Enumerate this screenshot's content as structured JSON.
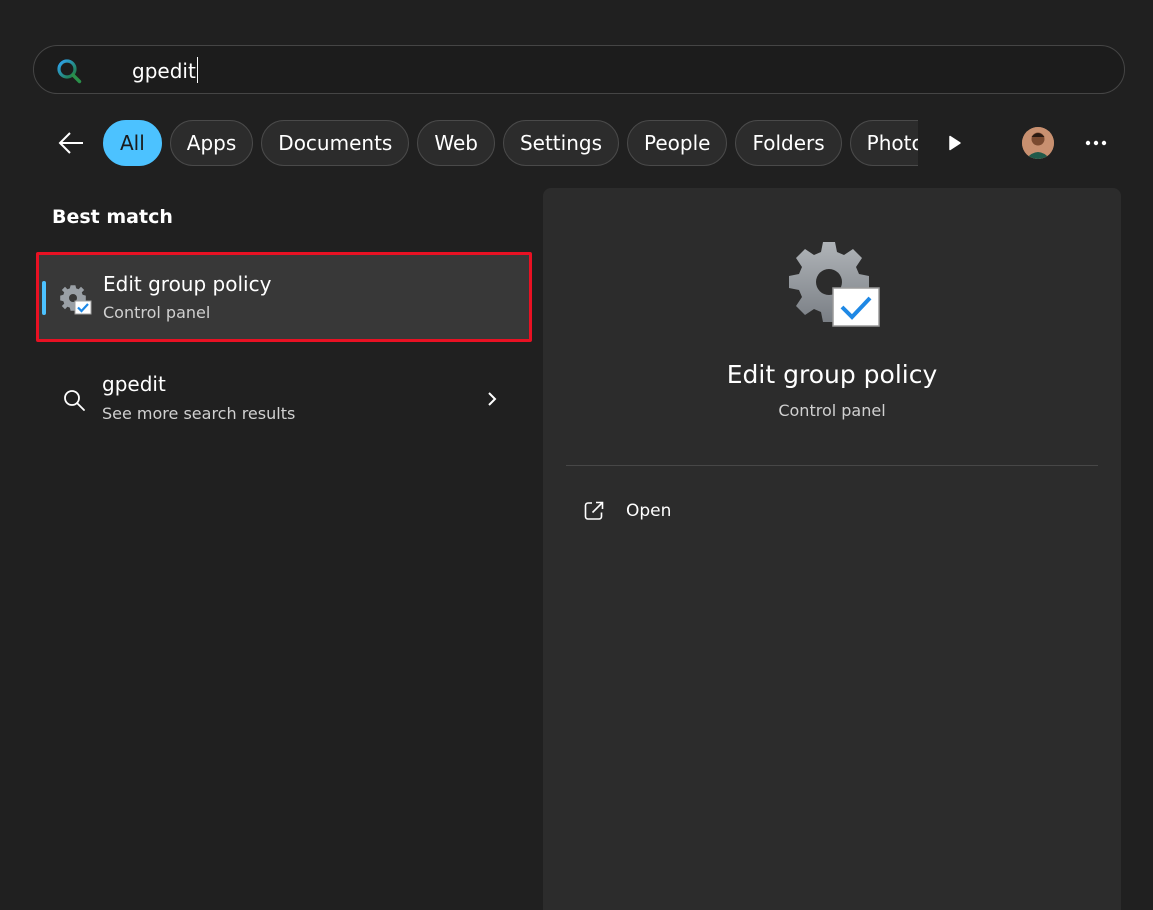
{
  "search": {
    "query": "gpedit"
  },
  "filters": [
    "All",
    "Apps",
    "Documents",
    "Web",
    "Settings",
    "People",
    "Folders",
    "Photos"
  ],
  "active_filter": "All",
  "best_match": {
    "heading": "Best match",
    "title": "Edit group policy",
    "subtitle": "Control panel"
  },
  "more_results": {
    "title": "gpedit",
    "subtitle": "See more search results"
  },
  "detail": {
    "title": "Edit group policy",
    "subtitle": "Control panel",
    "action_open": "Open"
  },
  "colors": {
    "accent": "#4cc2ff",
    "highlight_border": "#e81123",
    "background": "#202020",
    "panel": "#2c2c2c"
  },
  "icons": {
    "search_logo": "search-logo-icon",
    "back": "arrow-left-icon",
    "more_chips": "play-arrow-icon",
    "overflow": "more-dots-icon",
    "result": "gear-check-icon",
    "search": "search-icon",
    "chevron": "chevron-right-icon",
    "open": "open-external-icon"
  }
}
